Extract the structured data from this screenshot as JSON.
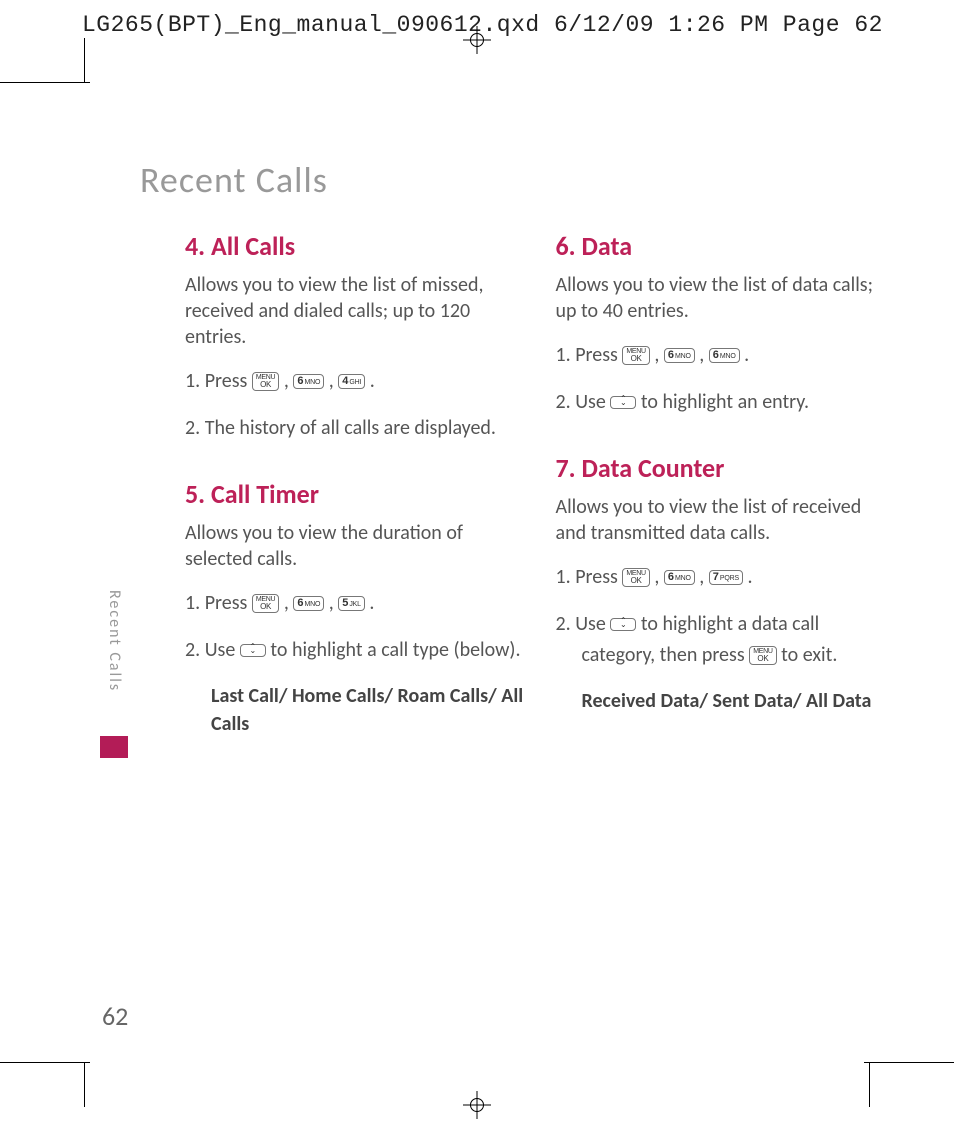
{
  "slug": "LG265(BPT)_Eng_manual_090612.qxd  6/12/09  1:26 PM  Page 62",
  "page_title": "Recent Calls",
  "side_label": "Recent Calls",
  "page_number": "62",
  "keys": {
    "ok_top": "MENU",
    "ok_bot": "OK",
    "k4": "4",
    "k4s": "GHI",
    "k5": "5",
    "k5s": "JKL",
    "k6": "6",
    "k6s": "MNO",
    "k7": "7",
    "k7s": "PQRS"
  },
  "sections": {
    "s4": {
      "heading": "4. All Calls",
      "desc": "Allows you to view the list of missed, received and dialed calls; up to 120 entries.",
      "step1a": "1. Press  ",
      "comma": " ,  ",
      "period": " .",
      "step2": "2. The history of all calls are displayed."
    },
    "s5": {
      "heading": "5. Call Timer",
      "desc": "Allows you to view the duration of selected calls.",
      "step1a": "1. Press  ",
      "step2a": "2. Use  ",
      "step2b": "  to highlight a call type (below).",
      "options": "Last Call/ Home Calls/ Roam Calls/ All Calls"
    },
    "s6": {
      "heading": "6. Data",
      "desc": "Allows you to view the list of data calls; up to 40 entries.",
      "step1a": "1. Press  ",
      "step2a": "2. Use  ",
      "step2b": "  to highlight an entry."
    },
    "s7": {
      "heading": "7. Data Counter",
      "desc": "Allows you to view the list of received and transmitted data calls.",
      "step1a": "1. Press  ",
      "step2a": "2. Use  ",
      "step2b": "  to highlight a data call category, then press  ",
      "step2c": " to exit.",
      "options": "Received Data/ Sent Data/ All Data"
    }
  }
}
